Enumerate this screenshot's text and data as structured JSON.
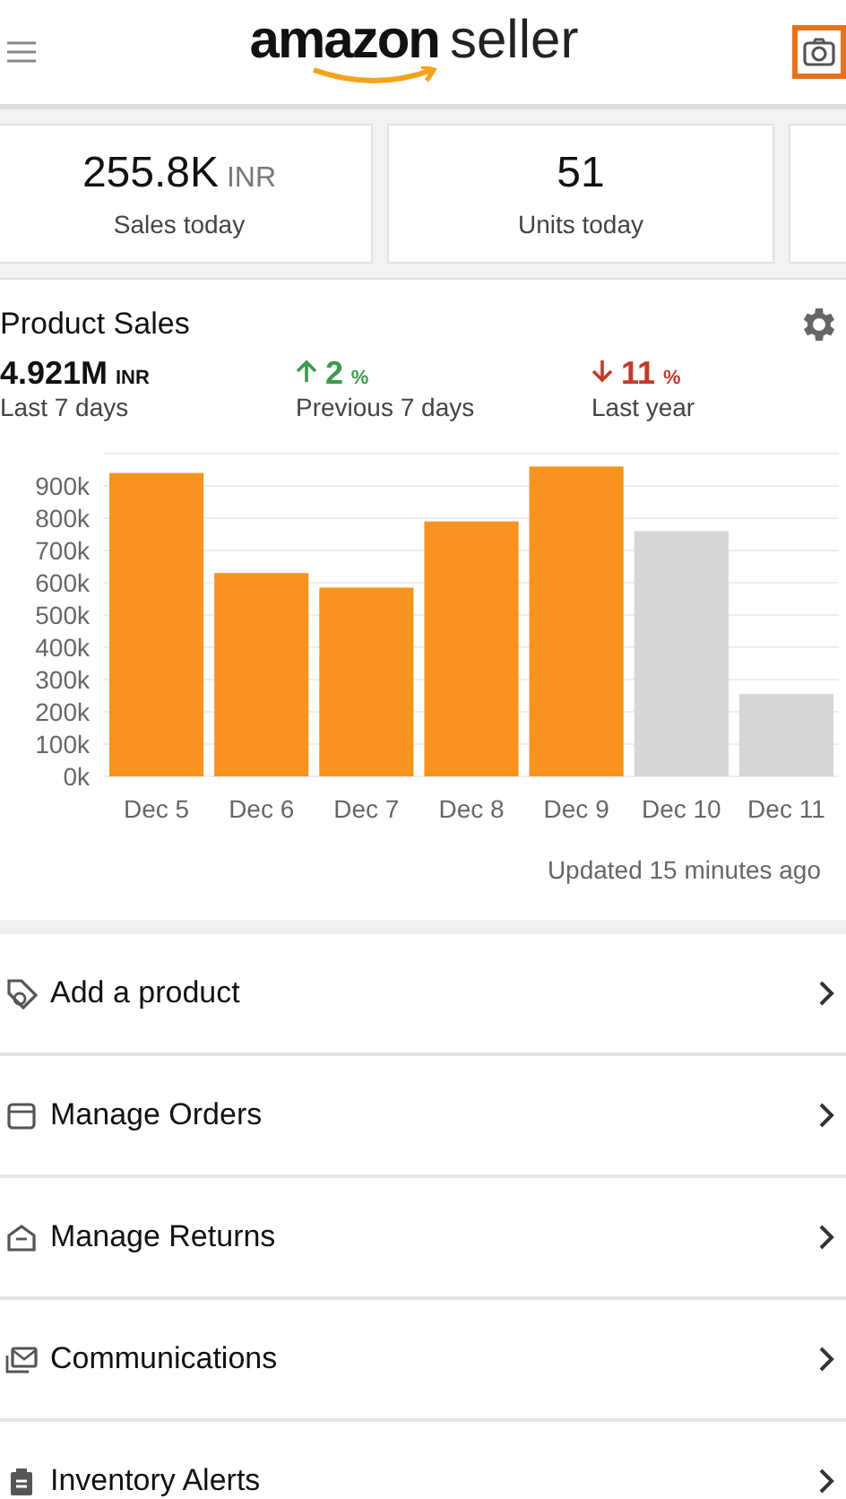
{
  "header": {
    "logo_brand": "amazon",
    "logo_suffix": "seller"
  },
  "stats": [
    {
      "value": "255.8K",
      "unit": "INR",
      "label": "Sales today"
    },
    {
      "value": "51",
      "label": "Units today"
    }
  ],
  "product_sales": {
    "title": "Product Sales",
    "total": {
      "value": "4.921M",
      "unit": "INR",
      "label": "Last 7 days"
    },
    "comparisons": [
      {
        "kind": "increase",
        "value": "2",
        "unit": "%",
        "label": "Previous 7 days"
      },
      {
        "kind": "decrease",
        "value": "11",
        "unit": "%",
        "label": "Last year"
      }
    ],
    "chart_data": {
      "type": "bar",
      "categories": [
        "Dec 5",
        "Dec 6",
        "Dec 7",
        "Dec 8",
        "Dec 9",
        "Dec 10",
        "Dec 11"
      ],
      "series": [
        {
          "color": "#f7931e",
          "values": [
            940000,
            630000,
            585000,
            790000,
            960000,
            null,
            null
          ]
        },
        {
          "color": "#d5d6d8",
          "values": [
            null,
            null,
            null,
            null,
            null,
            760000,
            255000
          ]
        }
      ],
      "stacked": true,
      "grid": true,
      "ylim": [
        0,
        1000000
      ],
      "yticks": [
        {
          "value": 0,
          "label": "0k"
        },
        {
          "value": 100000,
          "label": "100k"
        },
        {
          "value": 200000,
          "label": "200k"
        },
        {
          "value": 300000,
          "label": "300k"
        },
        {
          "value": 400000,
          "label": "400k"
        },
        {
          "value": 500000,
          "label": "500k"
        },
        {
          "value": 600000,
          "label": "600k"
        },
        {
          "value": 700000,
          "label": "700k"
        },
        {
          "value": 800000,
          "label": "800k"
        },
        {
          "value": 900000,
          "label": "900k"
        }
      ]
    },
    "updated": "Updated 15 minutes ago"
  },
  "menu": [
    {
      "kind": "tag",
      "label": "Add a product"
    },
    {
      "kind": "box",
      "label": "Manage Orders"
    },
    {
      "kind": "return",
      "label": "Manage Returns"
    },
    {
      "kind": "mail",
      "label": "Communications"
    },
    {
      "kind": "clipboard",
      "label": "Inventory Alerts"
    }
  ]
}
